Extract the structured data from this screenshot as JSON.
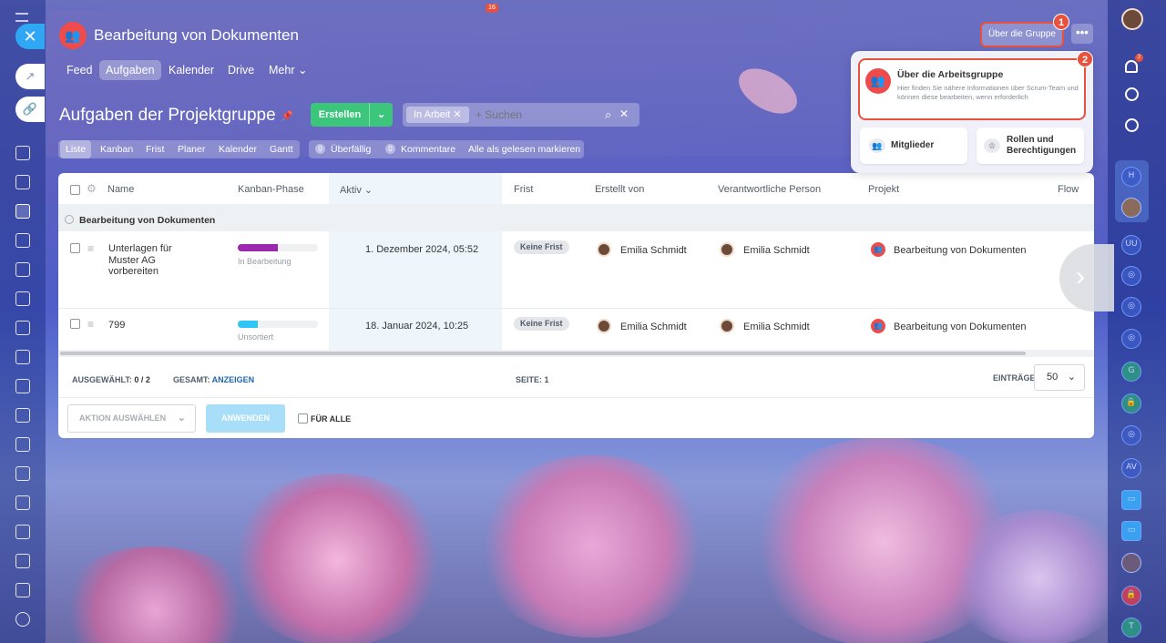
{
  "window": {
    "notification_count": "16"
  },
  "header": {
    "group_title": "Bearbeitung von Dokumenten",
    "about_button": "Über die Gruppe",
    "more_button": "•••",
    "badge1": "1",
    "badge2": "2"
  },
  "tabs": [
    {
      "label": "Feed"
    },
    {
      "label": "Aufgaben"
    },
    {
      "label": "Kalender"
    },
    {
      "label": "Drive"
    },
    {
      "label": "Mehr ⌄"
    }
  ],
  "toolbar": {
    "page_title": "Aufgaben der Projektgruppe",
    "create_label": "Erstellen",
    "filter_chip": "In Arbeit",
    "search_placeholder": "+ Suchen"
  },
  "view_tabs": [
    "Liste",
    "Kanban",
    "Frist",
    "Planer",
    "Kalender",
    "Gantt"
  ],
  "counters": {
    "overdue_count": "0",
    "overdue_label": "Überfällig",
    "comments_count": "0",
    "comments_label": "Kommentare",
    "mark_read": "Alle als gelesen markieren"
  },
  "table": {
    "columns": [
      "Name",
      "Kanban-Phase",
      "Aktiv ⌄",
      "Frist",
      "Erstellt von",
      "Verantwortliche Person",
      "Projekt",
      "Flow"
    ],
    "group_label": "Bearbeitung von Dokumenten",
    "rows": [
      {
        "name": "Unterlagen für Muster AG vorbereiten",
        "phase": "In Bearbeitung",
        "progress": 0.5,
        "phase_color": "#9c27b0",
        "active": "1. Dezember 2024, 05:52",
        "deadline": "Keine Frist",
        "creator": "Emilia Schmidt",
        "responsible": "Emilia Schmidt",
        "project": "Bearbeitung von Dokumenten"
      },
      {
        "name": "799",
        "phase": "Unsortiert",
        "progress": 0.25,
        "phase_color": "#2fc6f6",
        "active": "18. Januar 2024, 10:25",
        "deadline": "Keine Frist",
        "creator": "Emilia Schmidt",
        "responsible": "Emilia Schmidt",
        "project": "Bearbeitung von Dokumenten"
      }
    ]
  },
  "footer": {
    "selected_label": "AUSGEWÄHLT:",
    "selected_value": "0 / 2",
    "total_label": "GESAMT:",
    "total_link": "ANZEIGEN",
    "page_label": "SEITE:",
    "page_value": "1",
    "entries_label": "EINTRÄGE",
    "entries_value": "50"
  },
  "actions": {
    "select_action": "AKTION AUSWÄHLEN",
    "apply": "ANWENDEN",
    "for_all": "FÜR ALLE"
  },
  "popup": {
    "about_title": "Über die Arbeitsgruppe",
    "about_desc": "Hier finden Sie nähere Informationen über Scrum-Team und können diese bearbeiten, wenn erforderlich",
    "members": "Mitglieder",
    "roles": "Rollen und Berechtigungen"
  },
  "right_sidebar": {
    "notifications": "2",
    "circles": [
      "H",
      "UU",
      "G",
      "AV",
      "T"
    ]
  },
  "colors": {
    "accent": "#3bc67c",
    "highlight": "#e8513d",
    "brand": "#2fa7f5"
  }
}
